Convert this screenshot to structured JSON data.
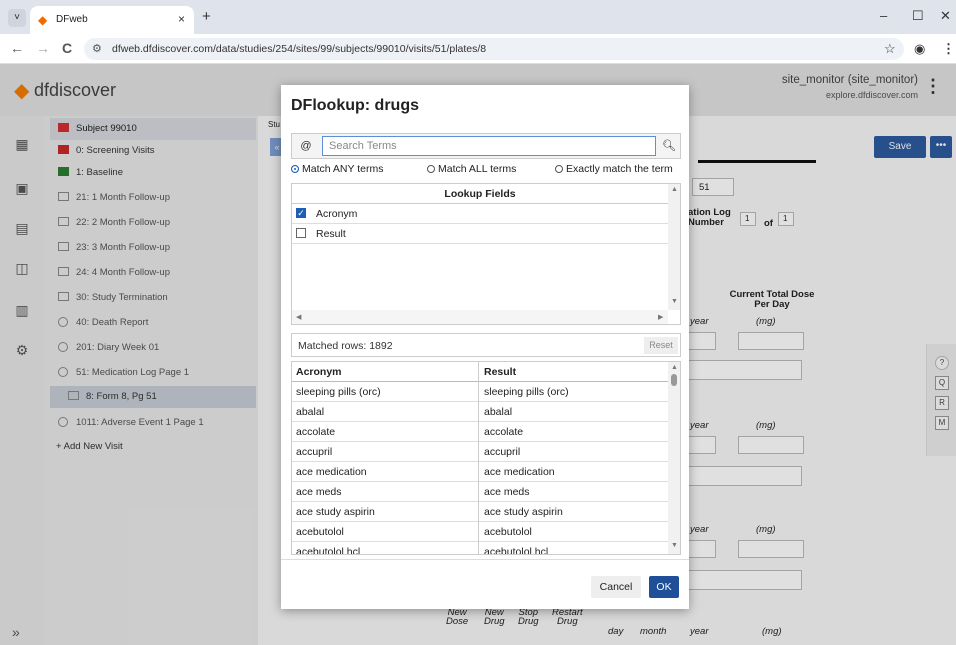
{
  "browser": {
    "tab_title": "DFweb",
    "tab_close": "×",
    "new_tab": "+",
    "url": "dfweb.dfdiscover.com/data/studies/254/sites/99/subjects/99010/visits/51/plates/8",
    "minimize": "–",
    "maximize": "☐",
    "close": "✕",
    "back": "←",
    "forward": "→",
    "reload": "C",
    "tab_menu": "˅"
  },
  "app": {
    "logo": "dfdiscover",
    "user": "site_monitor (site_monitor)",
    "host": "explore.dfdiscover.com",
    "save_label": "Save",
    "more_label": "•••",
    "collapse_label": "«",
    "tree": [
      {
        "label": "Subject 99010"
      },
      {
        "label": "0: Screening Visits"
      },
      {
        "label": "1: Baseline"
      },
      {
        "label": "21: 1 Month Follow-up"
      },
      {
        "label": "22: 2 Month Follow-up"
      },
      {
        "label": "23: 3 Month Follow-up"
      },
      {
        "label": "24: 4 Month Follow-up"
      },
      {
        "label": "30: Study Termination"
      },
      {
        "label": "40: Death Report"
      },
      {
        "label": "201: Diary Week 01"
      },
      {
        "label": "51: Medication Log Page 1"
      },
      {
        "label": "8: Form 8, Pg 51"
      },
      {
        "label": "1011: Adverse Event 1 Page 1"
      },
      {
        "label": "+ Add New Visit"
      }
    ],
    "bg": {
      "stub": "Stu",
      "visit_num": "51",
      "log_title": "ation Log\nNumber",
      "page_field": "1",
      "of_label": "of",
      "of_value": "1",
      "current_dose": "Current Total Dose\nPer Day",
      "year": "year",
      "mg": "(mg)",
      "col_new_dose": "New\nDose",
      "col_new_drug": "New\nDrug",
      "col_stop_drug": "Stop\nDrug",
      "col_restart": "Restart\nDrug",
      "col_day": "day",
      "col_month": "month"
    },
    "side_tools": [
      "?",
      "Q",
      "R",
      "M"
    ],
    "expand": "»"
  },
  "dialog": {
    "title": "DFlookup: drugs",
    "at_label": "@",
    "search_placeholder": "Search Terms",
    "search_value": "",
    "radios": [
      "Match ANY terms",
      "Match ALL terms",
      "Exactly match the term"
    ],
    "lookup_header": "Lookup Fields",
    "fields": [
      {
        "label": "Acronym",
        "checked": true
      },
      {
        "label": "Result",
        "checked": false
      }
    ],
    "matched": "Matched rows: 1892",
    "reset": "Reset",
    "columns": [
      "Acronym",
      "Result"
    ],
    "rows": [
      [
        "sleeping pills (orc)",
        "sleeping pills (orc)"
      ],
      [
        "abalal",
        "abalal"
      ],
      [
        "accolate",
        "accolate"
      ],
      [
        "accupril",
        "accupril"
      ],
      [
        "ace medication",
        "ace medication"
      ],
      [
        "ace meds",
        "ace meds"
      ],
      [
        "ace study aspirin",
        "ace study aspirin"
      ],
      [
        "acebutolol",
        "acebutolol"
      ],
      [
        "acebutolol hcl",
        "acebutolol hcl"
      ]
    ],
    "cancel": "Cancel",
    "ok": "OK"
  }
}
